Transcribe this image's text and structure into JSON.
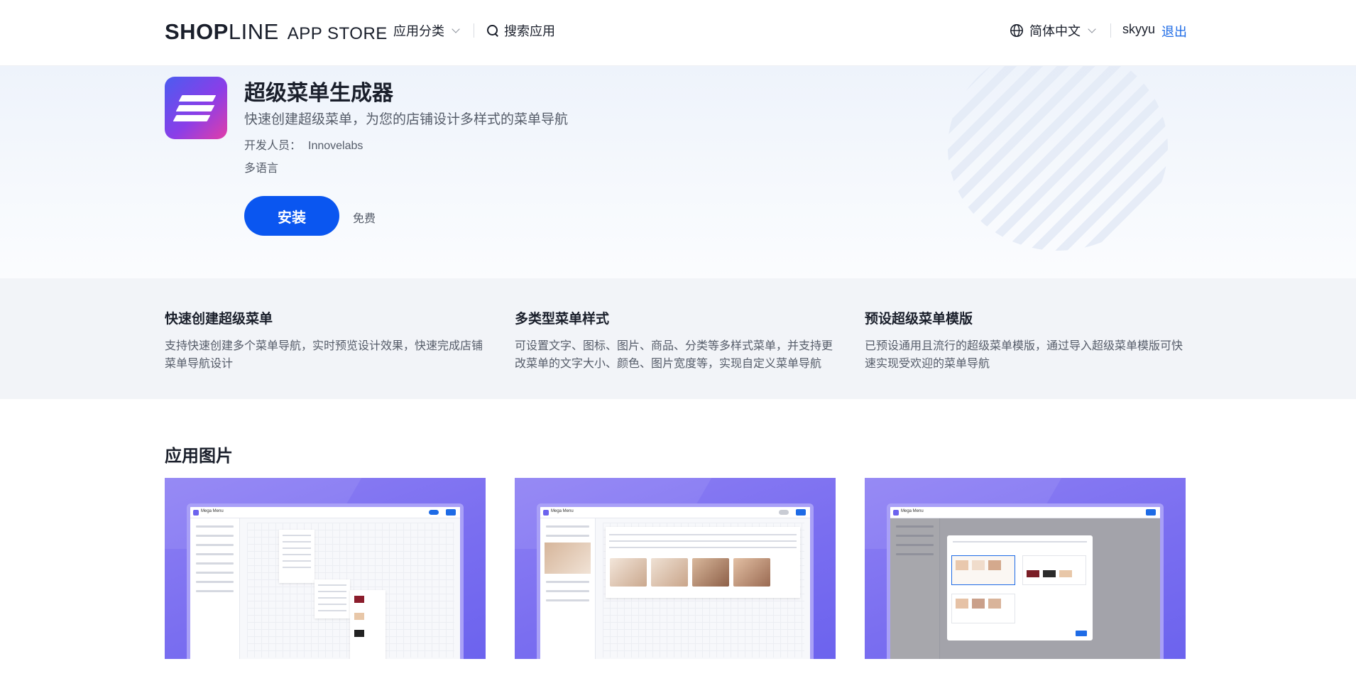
{
  "header": {
    "logo_bold": "SHOP",
    "logo_light": "LINE",
    "logo_store": "APP STORE",
    "nav_category": "应用分类",
    "nav_search": "搜索应用",
    "language": "简体中文",
    "username": "skyyu",
    "logout": "退出"
  },
  "app": {
    "title": "超级菜单生成器",
    "subtitle": "快速创建超级菜单，为您的店铺设计多样式的菜单导航",
    "developer_label": "开发人员：",
    "developer_name": "Innovelabs",
    "language_support": "多语言",
    "install_label": "安装",
    "price": "免费",
    "icon_colors": [
      "#4b5cf0",
      "#8a3ee8",
      "#e23da8"
    ]
  },
  "features": [
    {
      "title": "快速创建超级菜单",
      "description": "支持快速创建多个菜单导航，实时预览设计效果，快速完成店铺菜单导航设计"
    },
    {
      "title": "多类型菜单样式",
      "description": "可设置文字、图标、图片、商品、分类等多样式菜单，并支持更改菜单的文字大小、颜色、图片宽度等，实现自定义菜单导航"
    },
    {
      "title": "预设超级菜单模版",
      "description": "已预设通用且流行的超级菜单模版，通过导入超级菜单模版可快速实现受欢迎的菜单导航"
    }
  ],
  "screenshots": {
    "section_title": "应用图片",
    "items": [
      {
        "name": "screenshot-1",
        "caption": "Mega Menu"
      },
      {
        "name": "screenshot-2",
        "caption": "Mega Menu"
      },
      {
        "name": "screenshot-3",
        "caption": "Mega Menu"
      }
    ]
  },
  "colors": {
    "accent": "#0a56f0",
    "link": "#1e6be6",
    "screenshot_bg": "#7a6ef0"
  }
}
